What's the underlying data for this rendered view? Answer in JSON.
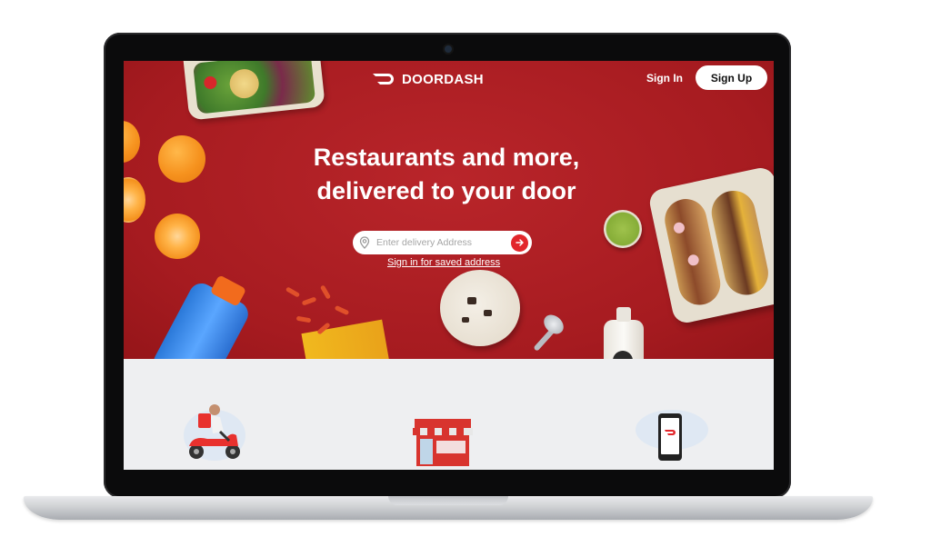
{
  "brand": {
    "name": "DOORDASH",
    "color": "#e2262b"
  },
  "header": {
    "sign_in_label": "Sign In",
    "sign_up_label": "Sign Up"
  },
  "hero": {
    "headline_line1": "Restaurants and more,",
    "headline_line2": "delivered to your door",
    "search_placeholder": "Enter delivery Address",
    "search_value": "",
    "saved_address_link": "Sign in for saved address",
    "background_color": "#b11f24"
  },
  "icons": {
    "location": "location-pin-icon",
    "submit": "arrow-right-icon",
    "logo": "doordash-logo-icon"
  },
  "lower_section": {
    "background_color": "#eeeff1",
    "illustrations": [
      "courier-scooter-illustration",
      "storefront-illustration",
      "mobile-app-illustration"
    ]
  }
}
